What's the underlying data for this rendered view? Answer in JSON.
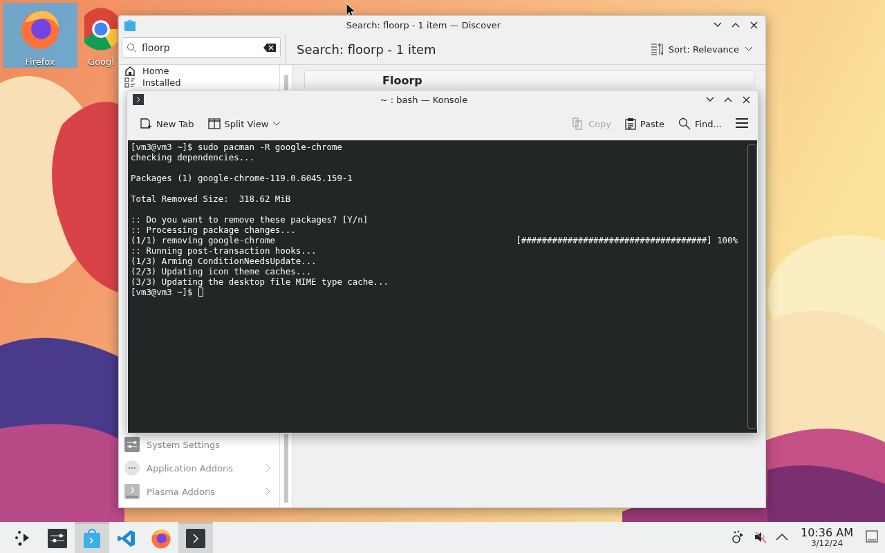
{
  "desktop": {
    "icons": [
      {
        "kind": "firefox",
        "label": "Firefox",
        "selected": true
      },
      {
        "kind": "chrome",
        "label": "Googl",
        "selected": false
      }
    ]
  },
  "discover": {
    "title": "Search: floorp - 1 item — Discover",
    "search": {
      "value": "floorp"
    },
    "sidebar": {
      "top_items": [
        {
          "kind": "home",
          "label": "Home",
          "submenu": false
        },
        {
          "kind": "installed",
          "label": "Installed",
          "submenu": false
        }
      ],
      "bottom_items": [
        {
          "kind": "settings",
          "label": "System Settings",
          "submenu": false
        },
        {
          "kind": "addons",
          "label": "Application Addons",
          "submenu": true
        },
        {
          "kind": "plasma",
          "label": "Plasma Addons",
          "submenu": true
        }
      ]
    },
    "heading": "Search: floorp - 1 item",
    "sort": "Sort: Relevance",
    "results": [
      {
        "name": "Floorp"
      }
    ]
  },
  "konsole": {
    "title": "~ : bash — Konsole",
    "toolbar_left": [
      {
        "kind": "newtab",
        "label": "New Tab",
        "disabled": false
      },
      {
        "kind": "split",
        "label": "Split View",
        "disabled": false
      }
    ],
    "toolbar_right": [
      {
        "kind": "copy",
        "label": "Copy",
        "disabled": true
      },
      {
        "kind": "paste",
        "label": "Paste",
        "disabled": false
      },
      {
        "kind": "find",
        "label": "Find...",
        "disabled": false
      }
    ],
    "lines": [
      {
        "kind": "text",
        "text": "[vm3@vm3 ~]$ sudo pacman -R google-chrome"
      },
      {
        "kind": "text",
        "text": "checking dependencies..."
      },
      {
        "kind": "blank"
      },
      {
        "kind": "text",
        "text": "Packages (1) google-chrome-119.0.6045.159-1"
      },
      {
        "kind": "blank"
      },
      {
        "kind": "text",
        "text": "Total Removed Size:  318.62 MiB"
      },
      {
        "kind": "blank"
      },
      {
        "kind": "text",
        "text": ":: Do you want to remove these packages? [Y/n]"
      },
      {
        "kind": "text",
        "text": ":: Processing package changes..."
      },
      {
        "kind": "progress",
        "text": "(1/1) removing google-chrome",
        "bar": "[####################################] 100%"
      },
      {
        "kind": "text",
        "text": ":: Running post-transaction hooks..."
      },
      {
        "kind": "text",
        "text": "(1/3) Arming ConditionNeedsUpdate..."
      },
      {
        "kind": "text",
        "text": "(2/3) Updating icon theme caches..."
      },
      {
        "kind": "text",
        "text": "(3/3) Updating the desktop file MIME type cache..."
      },
      {
        "kind": "prompt",
        "text": "[vm3@vm3 ~]$"
      }
    ]
  },
  "taskbar": {
    "apps": [
      {
        "kind": "launcher",
        "active": false
      },
      {
        "kind": "settings",
        "active": false
      },
      {
        "kind": "discover",
        "active": true
      },
      {
        "kind": "vscode",
        "active": false
      },
      {
        "kind": "firefox",
        "active": false
      },
      {
        "kind": "konsole",
        "active": true
      }
    ],
    "tray": [
      {
        "kind": "network"
      },
      {
        "kind": "muted"
      },
      {
        "kind": "expand"
      }
    ],
    "clock": {
      "time": "10:36 AM",
      "date": "3/12/24"
    }
  }
}
